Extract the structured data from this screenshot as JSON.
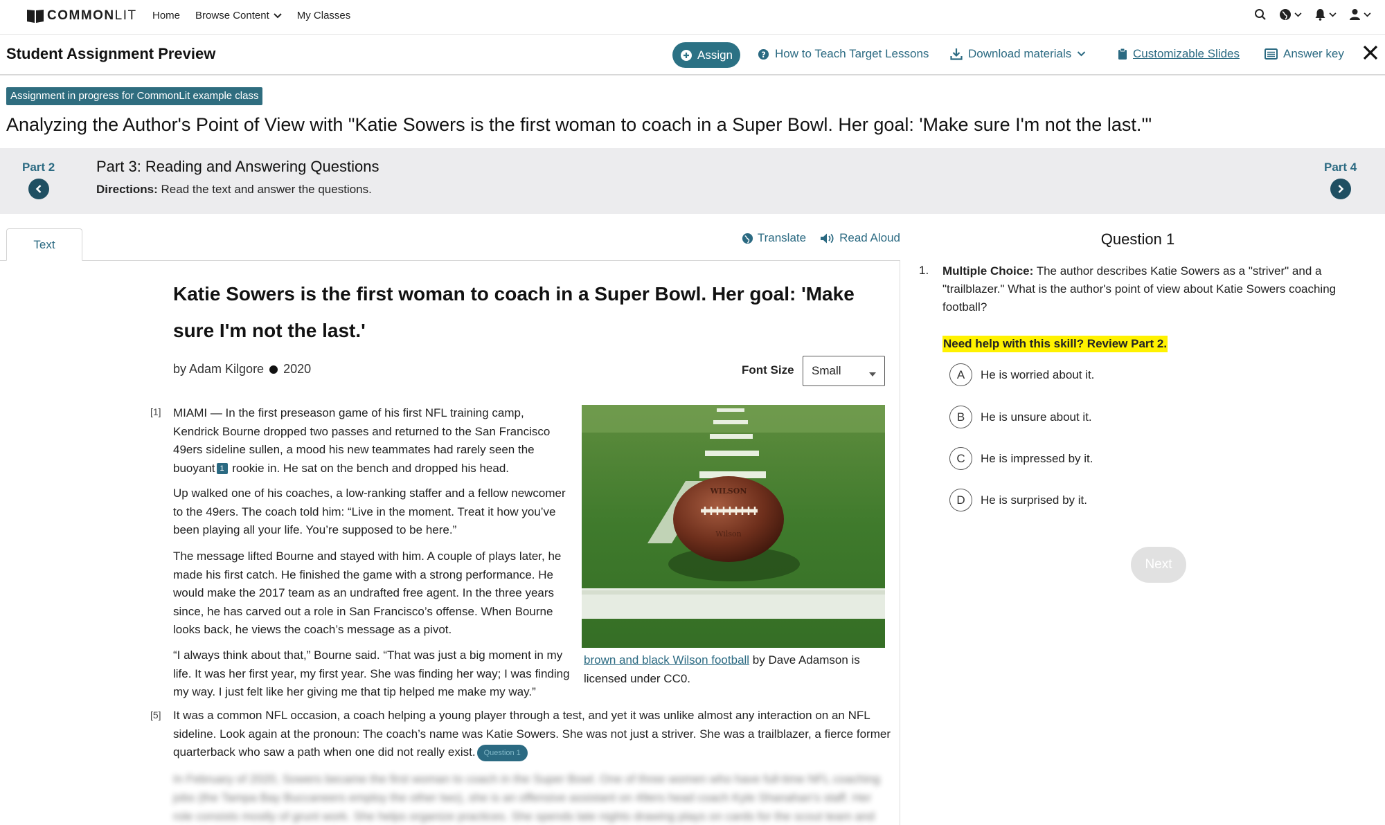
{
  "nav": {
    "logo_text": "COMMON",
    "logo_text2": "LIT",
    "home": "Home",
    "browse": "Browse Content",
    "classes": "My Classes",
    "icons": [
      "search-icon",
      "globe-icon",
      "bell-icon",
      "user-icon"
    ]
  },
  "preview": {
    "title": "Student Assignment Preview",
    "assign": "Assign",
    "teach": "How to Teach Target Lessons",
    "download": "Download materials",
    "slides": "Customizable Slides",
    "answer_key": "Answer key"
  },
  "banner": "Assignment in progress for CommonLit example class",
  "assignment_title": "Analyzing the Author's Point of View with \"Katie Sowers is the first woman to coach in a Super Bowl. Her goal: 'Make sure I'm not the last.'\"",
  "parts": {
    "prev": "Part 2",
    "next": "Part 4",
    "title": "Part 3: Reading and Answering Questions",
    "directions_label": "Directions:",
    "directions": "Read the text and answer the questions."
  },
  "reader": {
    "tab": "Text",
    "translate": "Translate",
    "read_aloud": "Read Aloud",
    "article_title": "Katie Sowers is the first woman to coach in a Super Bowl. Her goal: 'Make sure I'm not the last.'",
    "author": "by Adam Kilgore",
    "year": "2020",
    "font_size_label": "Font Size",
    "font_size_value": "Small",
    "p1_num": "[1]",
    "p1_a": "MIAMI — In the first preseason game of his first NFL training camp, Kendrick Bourne dropped two passes and returned to the San Francisco 49ers sideline sullen, a mood his new teammates had rarely seen the buoyant",
    "p1_fn": "1",
    "p1_b": " rookie in. He sat on the bench and dropped his head.",
    "p2": "Up walked one of his coaches, a low-ranking staffer and a fellow newcomer to the 49ers. The coach told him: “Live in the moment. Treat it how you’ve been playing all your life. You’re supposed to be here.”",
    "p3": "The message lifted Bourne and stayed with him. A couple of plays later, he made his first catch. He finished the game with a strong performance. He would make the 2017 team as an undrafted free agent. In the three years since, he has carved out a role in San Francisco’s offense. When Bourne looks back, he views the coach’s message as a pivot.",
    "p4": "“I always think about that,” Bourne said. “That was just a big moment in my life. It was her first year, my first year. She was finding her way; I was finding my way. I just felt like her giving me that tip helped me make my way.”",
    "p5_num": "[5]",
    "p5": "It was a common NFL occasion, a coach helping a young player through a test, and yet it was unlike almost any interaction on an NFL sideline. Look again at the pronoun: The coach’s name was Katie Sowers. She was not just a striver. She was a trailblazer, a fierce former quarterback who saw a path when one did not really exist.",
    "question_chip": "Question 1",
    "caption_link": "brown and black Wilson football",
    "caption_rest": " by Dave Adamson is licensed under CC0.",
    "blurred": "In February of 2020, Sowers became the first woman to coach in the Super Bowl. One of three women who have full-time NFL coaching jobs (the Tampa Bay Buccaneers employ the other two), she is an offensive assistant on 49ers head coach Kyle Shanahan’s staff. Her role consists mostly of grunt work. She helps organize practices. She spends late nights drawing plays on cards for the scout team and works"
  },
  "question": {
    "heading": "Question 1",
    "number": "1.",
    "type_label": "Multiple Choice:",
    "prompt": "The author describes Katie Sowers as a \"striver\" and a \"trailblazer.\" What is the author's point of view about Katie Sowers coaching football?",
    "help": "Need help with this skill? Review Part 2.",
    "choices": [
      {
        "letter": "A",
        "text": "He is worried about it."
      },
      {
        "letter": "B",
        "text": "He is unsure about it."
      },
      {
        "letter": "C",
        "text": "He is impressed by it."
      },
      {
        "letter": "D",
        "text": "He is surprised by it."
      }
    ],
    "next": "Next"
  },
  "colors": {
    "brand": "#2b6a82",
    "assign_bg": "#2b7184",
    "banner_bg": "#2f6d7f",
    "highlight": "#fff200"
  }
}
